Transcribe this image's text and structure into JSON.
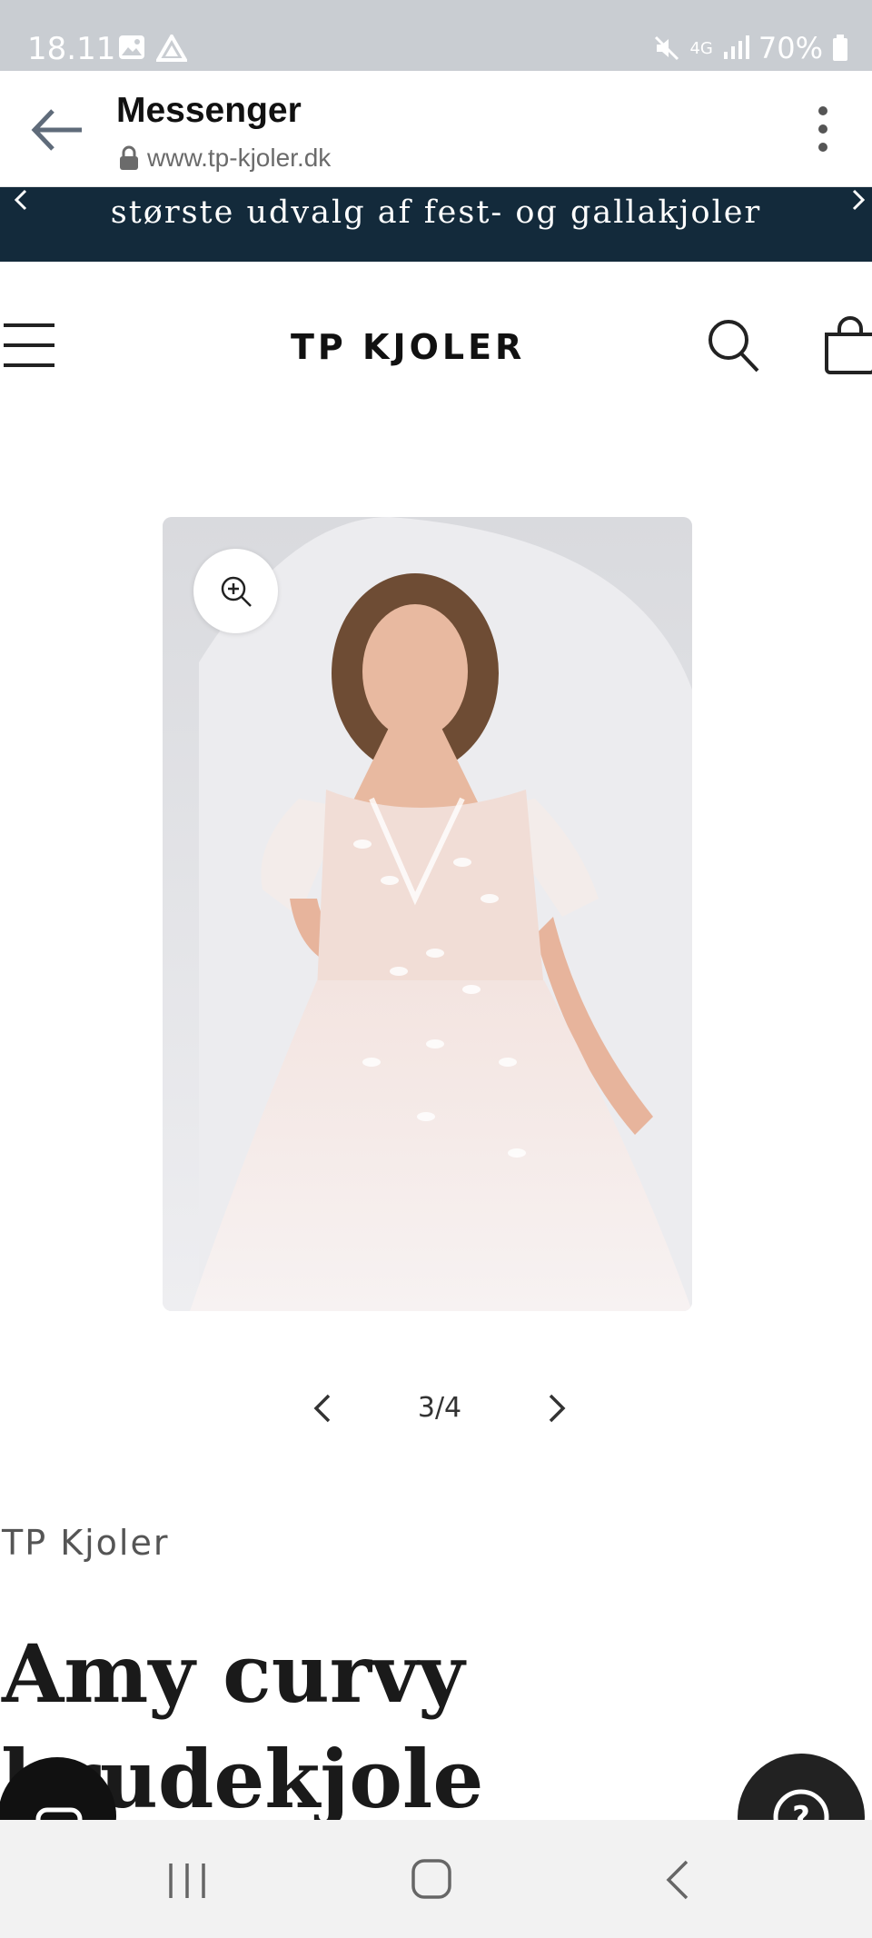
{
  "status_bar": {
    "time": "18.11",
    "network": "4G",
    "battery": "70%"
  },
  "browser": {
    "title": "Messenger",
    "url": "www.tp-kjoler.dk"
  },
  "announcement": {
    "text": "største udvalg af fest- og gallakjoler"
  },
  "header": {
    "logo": "TP KJOLER"
  },
  "gallery": {
    "counter": "3/4"
  },
  "product": {
    "vendor": "TP Kjoler",
    "title": "Amy curvy brudekjole"
  },
  "icons": [
    "back-arrow-icon",
    "lock-icon",
    "more-vertical-icon",
    "chevron-left-icon",
    "chevron-right-icon",
    "hamburger-menu-icon",
    "search-icon",
    "cart-icon",
    "zoom-in-icon",
    "chat-icon",
    "help-icon",
    "recents-icon",
    "home-icon",
    "nav-back-icon"
  ],
  "colors": {
    "announcement_bg": "#132a3b",
    "status_bar_bg": "#c9cdd2"
  }
}
